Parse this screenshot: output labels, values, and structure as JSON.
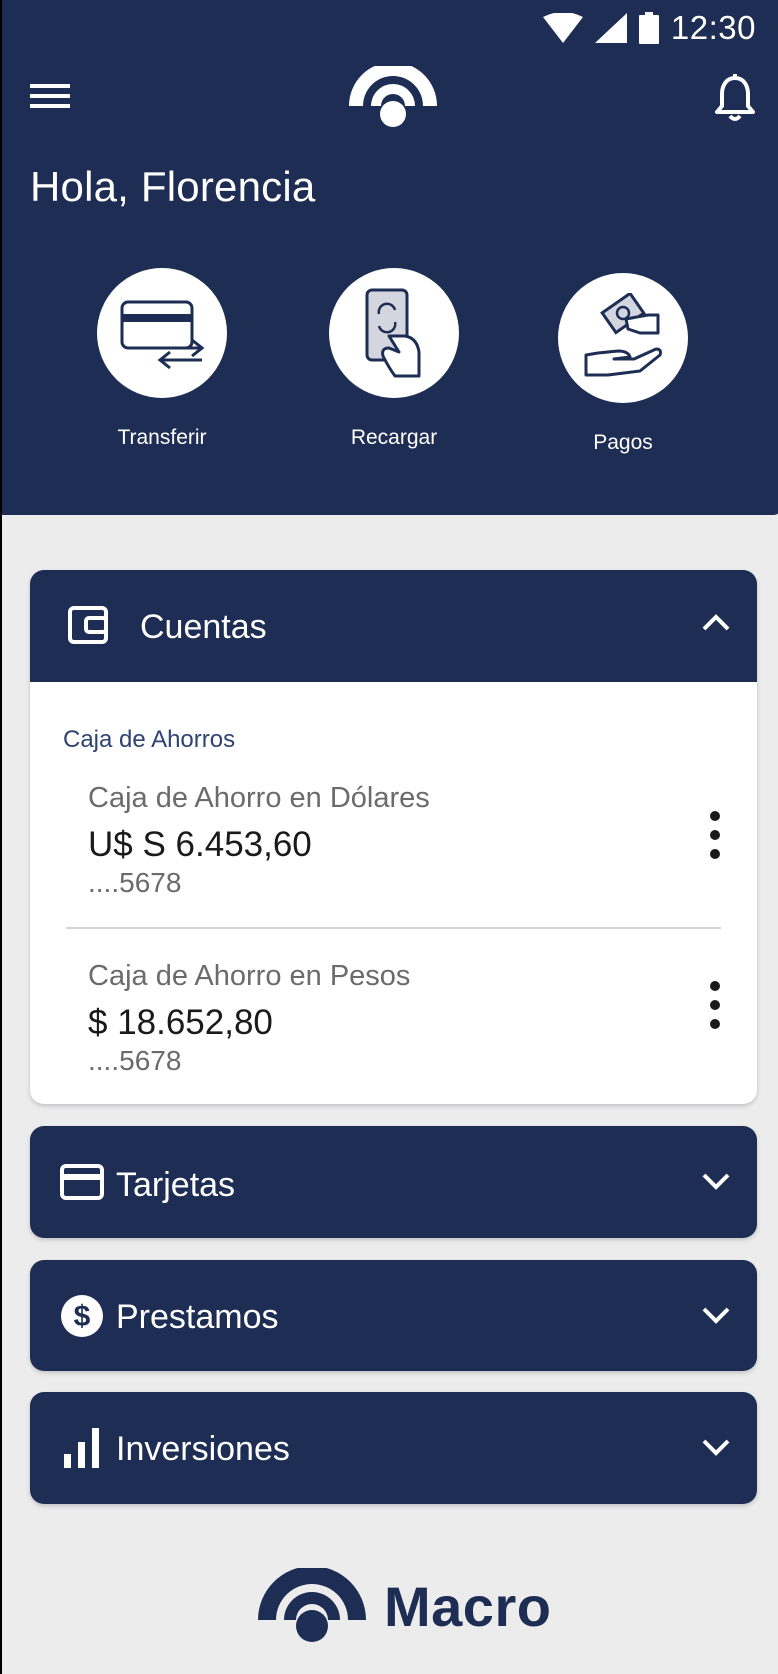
{
  "status_bar": {
    "time": "12:30"
  },
  "header": {
    "greeting": "Hola, Florencia"
  },
  "actions": [
    {
      "label": "Transferir",
      "icon": "card-transfer-icon"
    },
    {
      "label": "Recargar",
      "icon": "phone-recharge-icon"
    },
    {
      "label": "Pagos",
      "icon": "hand-payment-icon"
    }
  ],
  "cuentas": {
    "title": "Cuentas",
    "section_label": "Caja de Ahorros",
    "accounts": [
      {
        "name": "Caja de Ahorro en Dólares",
        "amount": "U$ S 6.453,60",
        "number": "....5678"
      },
      {
        "name": "Caja de Ahorro en Pesos",
        "amount": "$ 18.652,80",
        "number": "....5678"
      }
    ]
  },
  "tarjetas": {
    "title": "Tarjetas"
  },
  "prestamos": {
    "title": "Prestamos"
  },
  "inversiones": {
    "title": "Inversiones"
  },
  "brand": {
    "name": "Macro"
  },
  "colors": {
    "primary": "#1e2d53",
    "background": "#ececed",
    "card": "#ffffff",
    "accent_text": "#2f4373"
  }
}
